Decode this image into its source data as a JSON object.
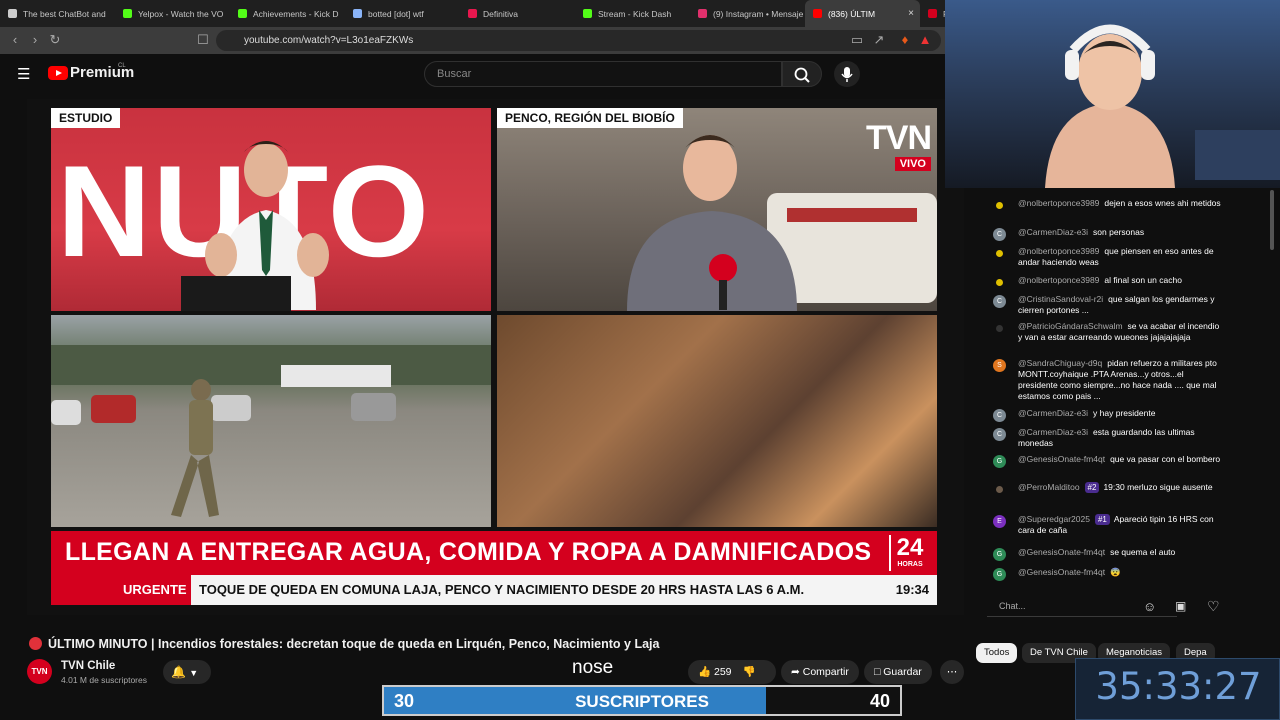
{
  "browser": {
    "tabs": [
      {
        "label": "The best ChatBot and",
        "color": "#cccccc"
      },
      {
        "label": "Yelpox - Watch the VO",
        "color": "#53fc18"
      },
      {
        "label": "Achievements - Kick D",
        "color": "#53fc18"
      },
      {
        "label": "botted [dot] wtf",
        "color": "#8ab4f8"
      },
      {
        "label": "Definitiva",
        "color": "#e8174e"
      },
      {
        "label": "Stream - Kick Dash",
        "color": "#53fc18"
      },
      {
        "label": "(9) Instagram • Mensaje",
        "color": "#e1306c"
      },
      {
        "label": "(836) ÚLTIM",
        "color": "#ff0000"
      },
      {
        "label": "Po",
        "color": "#d4001e"
      }
    ],
    "url": "youtube.com/watch?v=L3o1eaFZKWs"
  },
  "yt": {
    "logo": "Premium",
    "region": "CL",
    "search_placeholder": "Buscar"
  },
  "video": {
    "tag_studio": "ESTUDIO",
    "studio_bg_text": "NUTO",
    "tag_location": "PENCO, REGIÓN DEL BIOBÍO",
    "tvn": "TVN",
    "vivo": "VIVO",
    "headline": "LLEGAN A ENTREGAR AGUA, COMIDA Y ROPA A DAMNIFICADOS",
    "logo24": "24",
    "logo24_sub": "HORAS",
    "urgent": "URGENTE",
    "ticker": "TOQUE DE QUEDA EN COMUNA LAJA, PENCO Y NACIMIENTO DESDE 20 HRS HASTA LAS 6 A.M.",
    "clock": "19:34",
    "title": "ÚLTIMO MINUTO | Incendios forestales: decretan toque de queda en Lirquén, Penco, Nacimiento y Laja",
    "channel": "TVN Chile",
    "channel_avatar": "TVN",
    "subscribers": "4.01 M de suscriptores",
    "likes": "259",
    "share": "Compartir",
    "save": "Guardar"
  },
  "chat": {
    "messages": [
      {
        "author": "@nolbertoponce3989",
        "text": "dejen a esos wnes ahi metidos",
        "avatar": "",
        "avatar_color": "#e0c000"
      },
      {
        "author": "@CarmenDiaz-e3i",
        "text": "son personas",
        "avatar": "C",
        "avatar_color": "#7d8a94"
      },
      {
        "author": "@nolbertoponce3989",
        "text": "que piensen en eso antes de andar haciendo weas",
        "avatar": "",
        "avatar_color": "#e0c000"
      },
      {
        "author": "@nolbertoponce3989",
        "text": "al final son un cacho",
        "avatar": "",
        "avatar_color": "#e0c000"
      },
      {
        "author": "@CristinaSandoval-r2i",
        "text": "que salgan los gendarmes y cierren portones ...",
        "avatar": "C",
        "avatar_color": "#7d8a94"
      },
      {
        "author": "@PatricioGándaraSchwalm",
        "text": "se va acabar el incendio y van a estar acarreando wueones jajajajajaja",
        "avatar": "",
        "avatar_color": "#333333"
      },
      {
        "author": "@SandraChiguay-d9q",
        "text": "pidan refuerzo a militares pto MONTT.coyhaique .PTA Arenas...y otros...el presidente como siempre...no hace nada .... que mal estamos como pais ...",
        "avatar": "S",
        "avatar_color": "#e0761f"
      },
      {
        "author": "@CarmenDiaz-e3i",
        "text": "y hay presidente",
        "avatar": "C",
        "avatar_color": "#7d8a94"
      },
      {
        "author": "@CarmenDiaz-e3i",
        "text": "esta guardando las ultimas monedas",
        "avatar": "C",
        "avatar_color": "#7d8a94"
      },
      {
        "author": "@GenesisOnate-fm4qt",
        "text": "que va pasar con el bombero",
        "avatar": "G",
        "avatar_color": "#2e8b57"
      },
      {
        "author": "@PerroMalditoo",
        "badge": "#2",
        "text": "19:30 merluzo sigue ausente",
        "avatar": "",
        "avatar_color": "#6b5a4a"
      },
      {
        "author": "@Superedgar2025",
        "badge": "#1",
        "text": "Apareció tipin 16 HRS con cara de caña",
        "avatar": "E",
        "avatar_color": "#7b2fbf"
      },
      {
        "author": "@GenesisOnate-fm4qt",
        "text": "se quema el auto",
        "avatar": "G",
        "avatar_color": "#2e8b57"
      },
      {
        "author": "@GenesisOnate-fm4qt",
        "text": "😨",
        "avatar": "G",
        "avatar_color": "#2e8b57"
      }
    ],
    "input_placeholder": "Chat...",
    "chips": [
      "Todos",
      "De TVN Chile",
      "Meganoticias",
      "Depa"
    ]
  },
  "overlay": {
    "caption": "nose",
    "sub_start": "30",
    "sub_label": "SUSCRIPTORES",
    "sub_goal": "40",
    "sub_progress": 0.74,
    "timer": "35:33:27"
  }
}
